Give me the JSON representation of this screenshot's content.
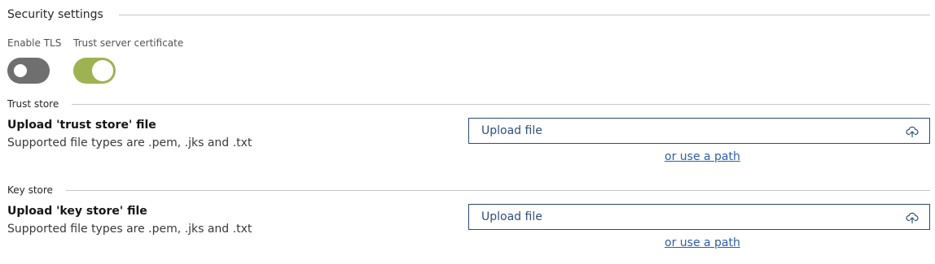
{
  "security": {
    "title": "Security settings",
    "enable_tls": {
      "label": "Enable TLS",
      "on": false
    },
    "trust_server_cert": {
      "label": "Trust server certificate",
      "on": true
    }
  },
  "trust_store": {
    "section_label": "Trust store",
    "title": "Upload 'trust store' file",
    "description": "Supported file types are .pem, .jks and .txt",
    "upload_label": "Upload file",
    "path_link": "or use a path"
  },
  "key_store": {
    "section_label": "Key store",
    "title": "Upload 'key store' file",
    "description": "Supported file types are .pem, .jks and .txt",
    "upload_label": "Upload file",
    "path_link": "or use a path"
  },
  "colors": {
    "toggle_on": "#9eb251",
    "toggle_off": "#6f6f6f",
    "link": "#2c5ca8",
    "upload_border": "#2b4a78"
  },
  "icons": {
    "upload": "cloud-upload-icon"
  }
}
